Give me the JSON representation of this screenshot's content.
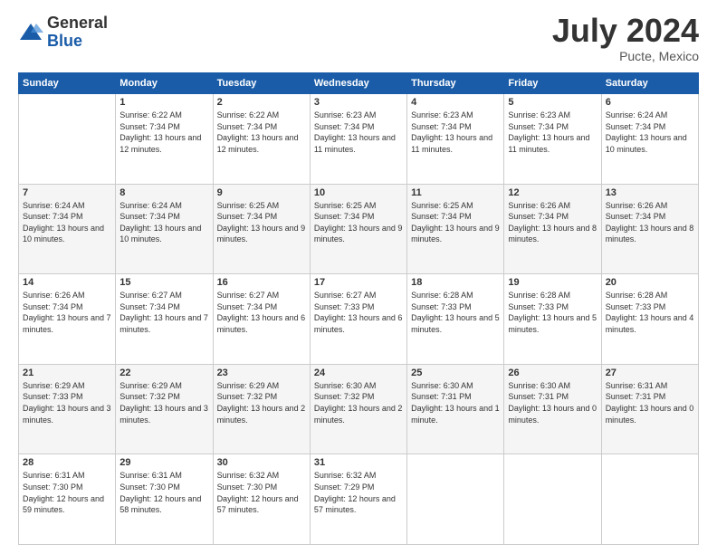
{
  "logo": {
    "general": "General",
    "blue": "Blue"
  },
  "header": {
    "month": "July 2024",
    "location": "Pucte, Mexico"
  },
  "days": [
    "Sunday",
    "Monday",
    "Tuesday",
    "Wednesday",
    "Thursday",
    "Friday",
    "Saturday"
  ],
  "weeks": [
    [
      {
        "day": "",
        "info": ""
      },
      {
        "day": "1",
        "info": "Sunrise: 6:22 AM\nSunset: 7:34 PM\nDaylight: 13 hours and 12 minutes."
      },
      {
        "day": "2",
        "info": "Sunrise: 6:22 AM\nSunset: 7:34 PM\nDaylight: 13 hours and 12 minutes."
      },
      {
        "day": "3",
        "info": "Sunrise: 6:23 AM\nSunset: 7:34 PM\nDaylight: 13 hours and 11 minutes."
      },
      {
        "day": "4",
        "info": "Sunrise: 6:23 AM\nSunset: 7:34 PM\nDaylight: 13 hours and 11 minutes."
      },
      {
        "day": "5",
        "info": "Sunrise: 6:23 AM\nSunset: 7:34 PM\nDaylight: 13 hours and 11 minutes."
      },
      {
        "day": "6",
        "info": "Sunrise: 6:24 AM\nSunset: 7:34 PM\nDaylight: 13 hours and 10 minutes."
      }
    ],
    [
      {
        "day": "7",
        "info": "Sunrise: 6:24 AM\nSunset: 7:34 PM\nDaylight: 13 hours and 10 minutes."
      },
      {
        "day": "8",
        "info": "Sunrise: 6:24 AM\nSunset: 7:34 PM\nDaylight: 13 hours and 10 minutes."
      },
      {
        "day": "9",
        "info": "Sunrise: 6:25 AM\nSunset: 7:34 PM\nDaylight: 13 hours and 9 minutes."
      },
      {
        "day": "10",
        "info": "Sunrise: 6:25 AM\nSunset: 7:34 PM\nDaylight: 13 hours and 9 minutes."
      },
      {
        "day": "11",
        "info": "Sunrise: 6:25 AM\nSunset: 7:34 PM\nDaylight: 13 hours and 9 minutes."
      },
      {
        "day": "12",
        "info": "Sunrise: 6:26 AM\nSunset: 7:34 PM\nDaylight: 13 hours and 8 minutes."
      },
      {
        "day": "13",
        "info": "Sunrise: 6:26 AM\nSunset: 7:34 PM\nDaylight: 13 hours and 8 minutes."
      }
    ],
    [
      {
        "day": "14",
        "info": "Sunrise: 6:26 AM\nSunset: 7:34 PM\nDaylight: 13 hours and 7 minutes."
      },
      {
        "day": "15",
        "info": "Sunrise: 6:27 AM\nSunset: 7:34 PM\nDaylight: 13 hours and 7 minutes."
      },
      {
        "day": "16",
        "info": "Sunrise: 6:27 AM\nSunset: 7:34 PM\nDaylight: 13 hours and 6 minutes."
      },
      {
        "day": "17",
        "info": "Sunrise: 6:27 AM\nSunset: 7:33 PM\nDaylight: 13 hours and 6 minutes."
      },
      {
        "day": "18",
        "info": "Sunrise: 6:28 AM\nSunset: 7:33 PM\nDaylight: 13 hours and 5 minutes."
      },
      {
        "day": "19",
        "info": "Sunrise: 6:28 AM\nSunset: 7:33 PM\nDaylight: 13 hours and 5 minutes."
      },
      {
        "day": "20",
        "info": "Sunrise: 6:28 AM\nSunset: 7:33 PM\nDaylight: 13 hours and 4 minutes."
      }
    ],
    [
      {
        "day": "21",
        "info": "Sunrise: 6:29 AM\nSunset: 7:33 PM\nDaylight: 13 hours and 3 minutes."
      },
      {
        "day": "22",
        "info": "Sunrise: 6:29 AM\nSunset: 7:32 PM\nDaylight: 13 hours and 3 minutes."
      },
      {
        "day": "23",
        "info": "Sunrise: 6:29 AM\nSunset: 7:32 PM\nDaylight: 13 hours and 2 minutes."
      },
      {
        "day": "24",
        "info": "Sunrise: 6:30 AM\nSunset: 7:32 PM\nDaylight: 13 hours and 2 minutes."
      },
      {
        "day": "25",
        "info": "Sunrise: 6:30 AM\nSunset: 7:31 PM\nDaylight: 13 hours and 1 minute."
      },
      {
        "day": "26",
        "info": "Sunrise: 6:30 AM\nSunset: 7:31 PM\nDaylight: 13 hours and 0 minutes."
      },
      {
        "day": "27",
        "info": "Sunrise: 6:31 AM\nSunset: 7:31 PM\nDaylight: 13 hours and 0 minutes."
      }
    ],
    [
      {
        "day": "28",
        "info": "Sunrise: 6:31 AM\nSunset: 7:30 PM\nDaylight: 12 hours and 59 minutes."
      },
      {
        "day": "29",
        "info": "Sunrise: 6:31 AM\nSunset: 7:30 PM\nDaylight: 12 hours and 58 minutes."
      },
      {
        "day": "30",
        "info": "Sunrise: 6:32 AM\nSunset: 7:30 PM\nDaylight: 12 hours and 57 minutes."
      },
      {
        "day": "31",
        "info": "Sunrise: 6:32 AM\nSunset: 7:29 PM\nDaylight: 12 hours and 57 minutes."
      },
      {
        "day": "",
        "info": ""
      },
      {
        "day": "",
        "info": ""
      },
      {
        "day": "",
        "info": ""
      }
    ]
  ]
}
